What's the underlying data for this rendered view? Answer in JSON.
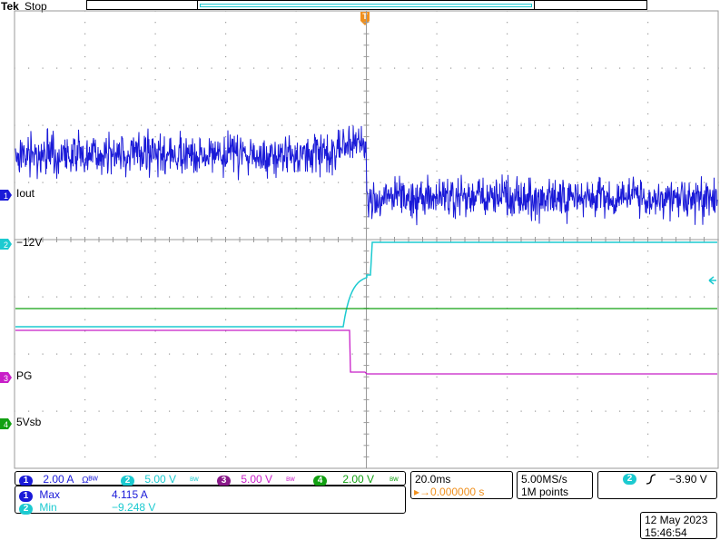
{
  "header": {
    "brand": "Tek",
    "acq_state": "Stop"
  },
  "trigger_marker": "T",
  "channel_labels": {
    "ch1": "Iout",
    "ch2": "−12V",
    "ch3": "PG",
    "ch4": "5Vsb"
  },
  "channels": [
    {
      "num": "1",
      "scale": "2.00 A",
      "extra": "Ωᴮᵂ",
      "color": "#1a1ad8"
    },
    {
      "num": "2",
      "scale": "5.00 V",
      "extra": "ᴮᵂ",
      "color": "#1ccad0"
    },
    {
      "num": "3",
      "scale": "5.00 V",
      "extra": "ᴮᵂ",
      "color": "#c81ec8"
    },
    {
      "num": "4",
      "scale": "2.00 V",
      "extra": "ᴮᵂ",
      "color": "#12a012"
    }
  ],
  "timebase": {
    "scale": "20.0ms",
    "trigger_pos": "▸→0.000000 s"
  },
  "acquisition": {
    "rate": "5.00MS/s",
    "points": "1M points"
  },
  "trigger": {
    "source": "2",
    "slope_icon": "rising-edge-icon",
    "level": "−3.90 V"
  },
  "measurements": [
    {
      "ch": "1",
      "name": "Max",
      "value": "4.115 A",
      "color": "#1a1ad8"
    },
    {
      "ch": "2",
      "name": "Min",
      "value": "−9.248 V",
      "color": "#1ccad0"
    }
  ],
  "datetime": {
    "date": "12 May 2023",
    "time": "15:46:54"
  },
  "colors": {
    "ch1": "#1a1ad8",
    "ch2": "#1ccad0",
    "ch3": "#c81ec8",
    "ch4": "#12a012",
    "grid": "#9a9a9a",
    "trigger": "#f0901e"
  }
}
